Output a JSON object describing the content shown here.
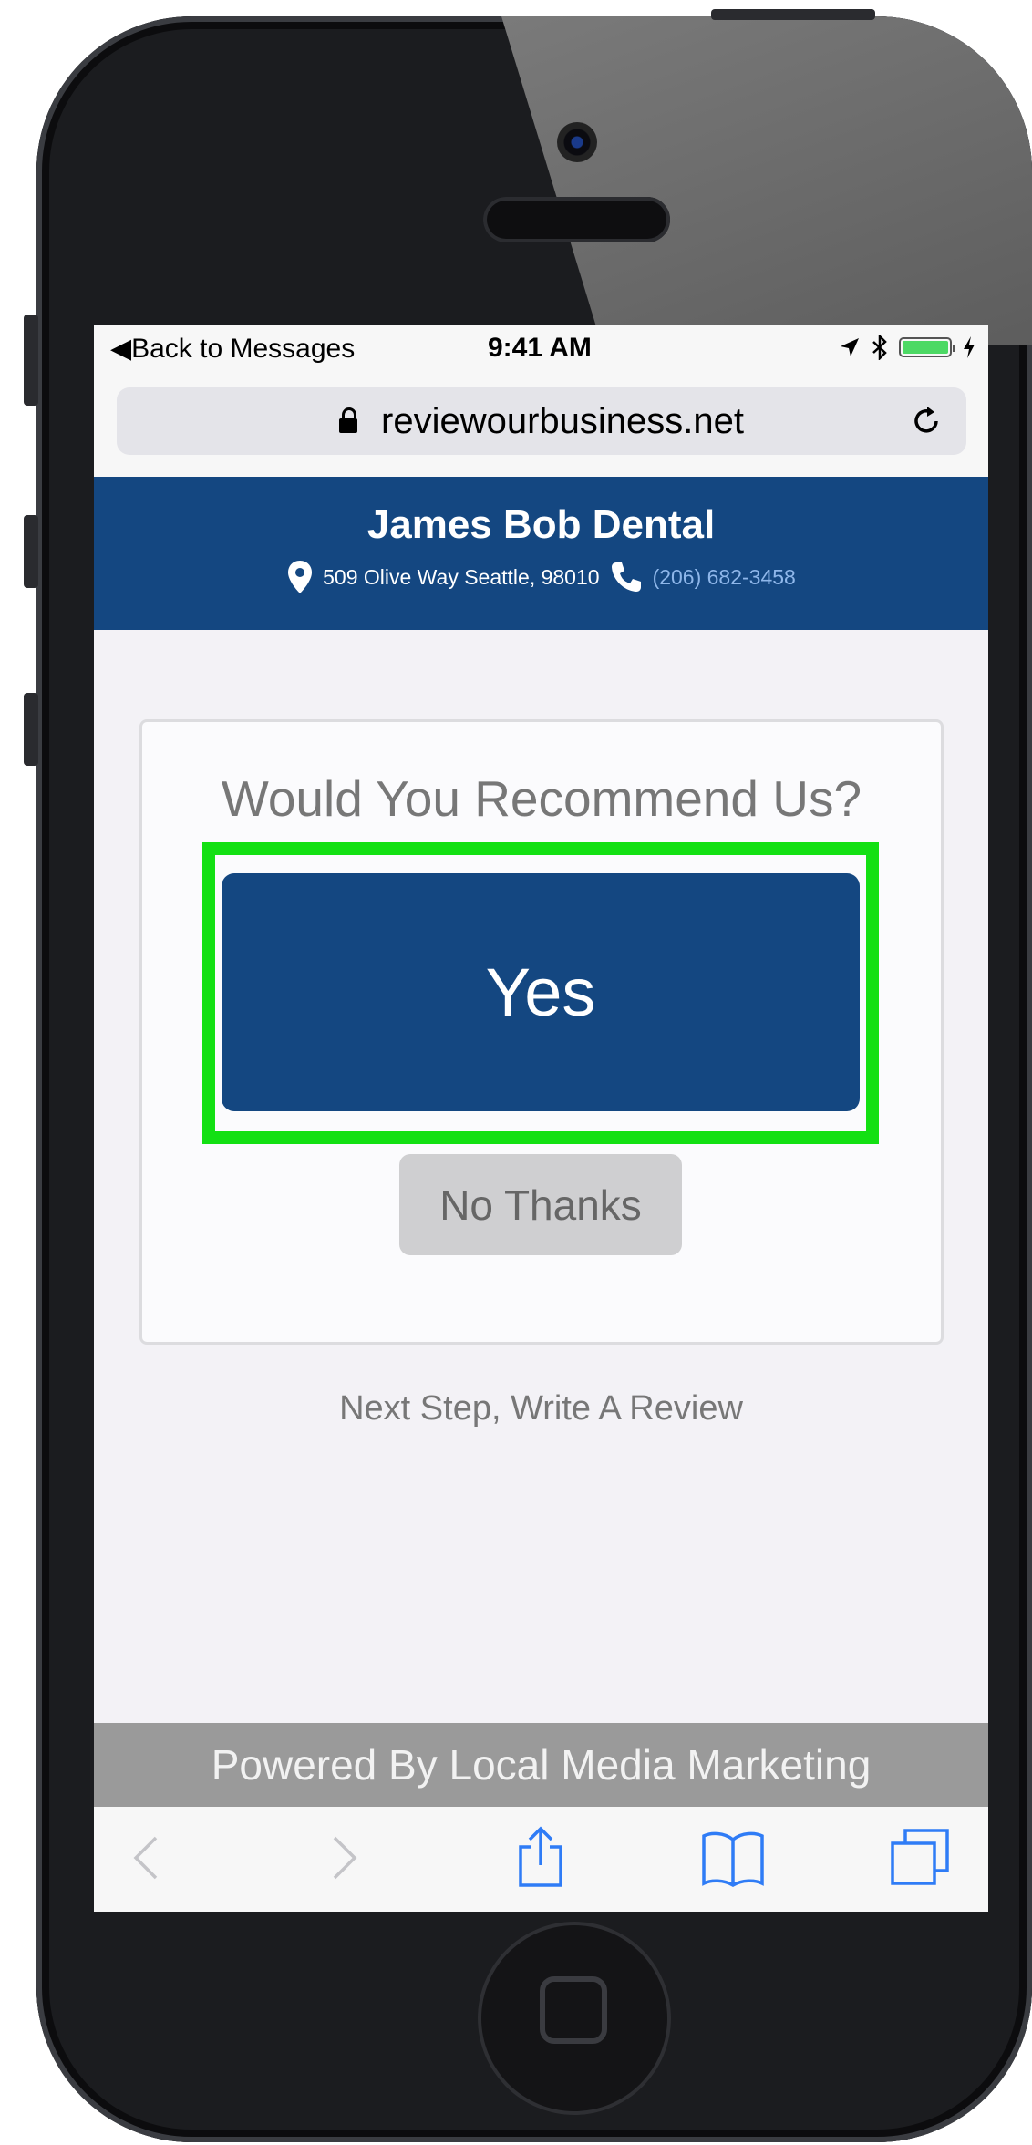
{
  "status_bar": {
    "back_label": "Back to Messages",
    "time": "9:41 AM"
  },
  "browser": {
    "url": "reviewourbusiness.net"
  },
  "business": {
    "name": "James Bob Dental",
    "address": "509 Olive Way Seattle, 98010",
    "phone": "(206) 682-3458"
  },
  "survey": {
    "question": "Would You Recommend Us?",
    "yes_label": "Yes",
    "no_label": "No Thanks"
  },
  "next_step": "Next Step, Write A Review",
  "footer": "Powered By Local Media Marketing",
  "colors": {
    "header_bg": "#144781",
    "highlight": "#13e013",
    "battery": "#4cd964"
  },
  "icons": [
    "location-arrow-icon",
    "bluetooth-icon",
    "battery-icon",
    "lock-icon",
    "reload-icon",
    "map-pin-icon",
    "phone-icon",
    "back-arrow-icon",
    "forward-arrow-icon",
    "share-icon",
    "bookmarks-icon",
    "tabs-icon"
  ]
}
